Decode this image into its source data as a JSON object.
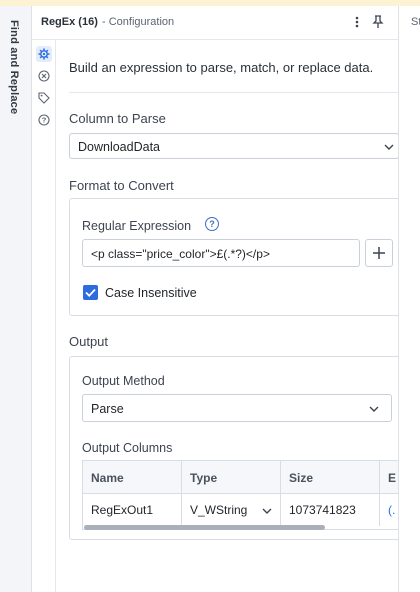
{
  "panel_rail": {
    "title": "Find and Replace"
  },
  "header": {
    "tool_name": "RegEx (16)",
    "subtitle": "- Configuration"
  },
  "icons": {
    "settings": "gear-icon",
    "tool": "regex-tool-icon",
    "tag": "tag-icon",
    "help": "help-icon",
    "more": "more-vertical-icon",
    "pin": "pin-icon"
  },
  "right_pane": {
    "tab_partial": "St"
  },
  "description": "Build an expression to parse, match, or replace data.",
  "column_to_parse": {
    "label": "Column to Parse",
    "value": "DownloadData"
  },
  "format_section": {
    "label": "Format to Convert",
    "regex_label": "Regular Expression",
    "regex_value": "<p class=\"price_color\">£(.*?)</p>",
    "case_insensitive_label": "Case Insensitive",
    "case_insensitive_checked": true
  },
  "output_section": {
    "label": "Output",
    "method_label": "Output Method",
    "method_value": "Parse",
    "columns_label": "Output Columns",
    "table": {
      "headers": [
        "Name",
        "Type",
        "Size",
        "E"
      ],
      "rows": [
        {
          "name": "RegExOut1",
          "type": "V_WString",
          "size": "1073741823",
          "extra": "(."
        }
      ]
    }
  },
  "colors": {
    "accent": "#2d6cdf",
    "rail_bg": "#f3f5f8",
    "top_strip": "#fbf3d3"
  }
}
